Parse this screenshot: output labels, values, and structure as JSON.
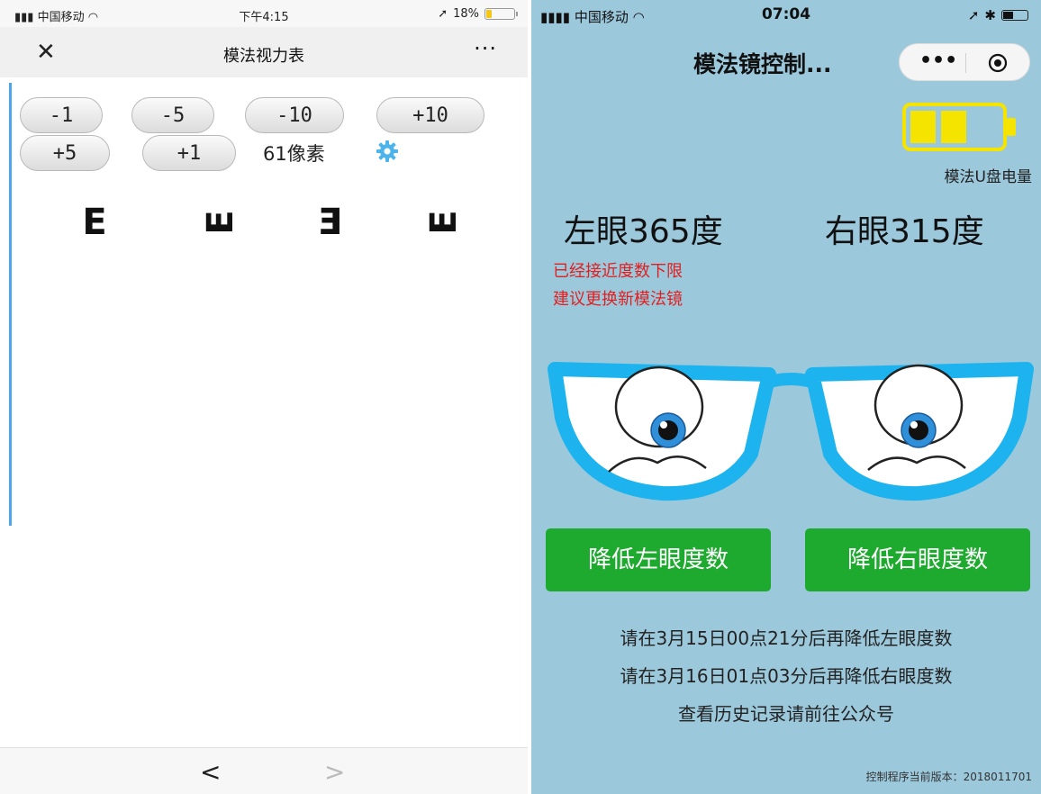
{
  "left": {
    "status": {
      "carrier": "中国移动",
      "time": "下午4:15",
      "battery": "18%",
      "battery_level": 0.18
    },
    "nav": {
      "close_icon": "close-icon",
      "title": "模法视力表",
      "more": "···"
    },
    "buttons": [
      "-1",
      "-5",
      "-10",
      "+10",
      "+5",
      "+1"
    ],
    "pixel_label": "61像素",
    "optotypes": [
      {
        "glyph": "E",
        "direction": "right"
      },
      {
        "glyph": "E",
        "direction": "up"
      },
      {
        "glyph": "E",
        "direction": "left"
      },
      {
        "glyph": "E",
        "direction": "up"
      }
    ],
    "bottom": {
      "back": "<",
      "forward": ">"
    },
    "accent": "#4da6e8"
  },
  "right": {
    "status": {
      "carrier": "中国移动",
      "time": "07:04"
    },
    "nav": {
      "title": "模法镜控制...",
      "more": "•••"
    },
    "battery": {
      "label": "模法U盘电量",
      "bars_filled": 2,
      "bars_total": 3,
      "color": "#f5e400"
    },
    "left_eye": "左眼365度",
    "right_eye": "右眼315度",
    "warnings": [
      "已经接近度数下限",
      "建议更换新模法镜"
    ],
    "buttons": {
      "lower_left": "降低左眼度数",
      "lower_right": "降低右眼度数"
    },
    "info": [
      "请在3月15日00点21分后再降低左眼度数",
      "请在3月16日01点03分后再降低右眼度数",
      "查看历史记录请前往公众号"
    ],
    "version": "控制程序当前版本：2018011701",
    "colors": {
      "background": "#9cc8dc",
      "button": "#1eaa2f",
      "warning": "#e02020",
      "frame": "#1cb3ee"
    }
  }
}
